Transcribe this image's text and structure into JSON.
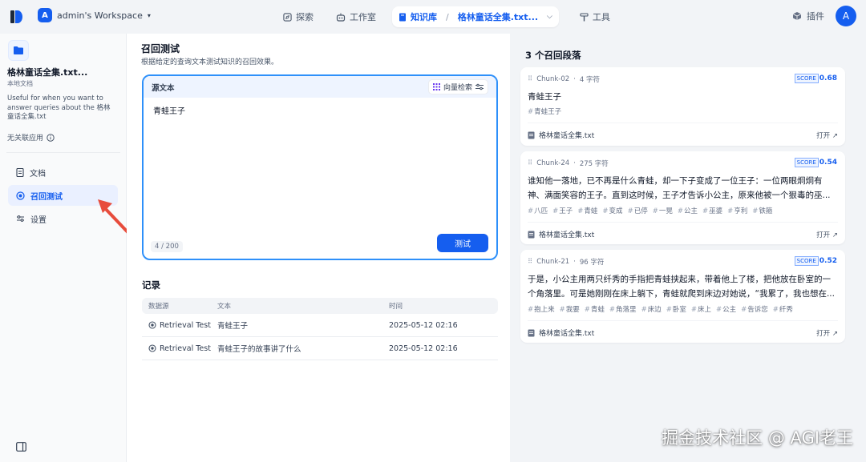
{
  "workspace": {
    "initial": "A",
    "name": "admin's Workspace"
  },
  "nav": {
    "explore": "探索",
    "studio": "工作室",
    "kb": "知识库",
    "kb_current": "格林童话全集.txt...",
    "tools": "工具"
  },
  "topright": {
    "plugins": "插件",
    "user_initial": "A"
  },
  "sidebar": {
    "kb_title": "格林童话全集.txt...",
    "kb_type": "本地文档",
    "kb_desc": "Useful for when you want to answer queries about the 格林童话全集.txt",
    "unlinked": "无关联应用",
    "items": [
      {
        "label": "文档"
      },
      {
        "label": "召回测试"
      },
      {
        "label": "设置"
      }
    ]
  },
  "main": {
    "title": "召回测试",
    "subtitle": "根据给定的查询文本测试知识的召回效果。",
    "source_label": "源文本",
    "vector_search": "向量检索",
    "query": "青蛙王子",
    "count": "4 / 200",
    "test_button": "测试",
    "records_title": "记录",
    "columns": [
      "数据源",
      "文本",
      "时间"
    ],
    "records": [
      {
        "source": "Retrieval Test",
        "text": "青蛙王子",
        "time": "2025-05-12 02:16"
      },
      {
        "source": "Retrieval Test",
        "text": "青蛙王子的故事讲了什么",
        "time": "2025-05-12 02:16"
      }
    ]
  },
  "results": {
    "title": "3 个召回段落",
    "score_label": "SCORE",
    "open": "打开 ↗",
    "chunks": [
      {
        "id": "Chunk-02",
        "chars": "4 字符",
        "score": "0.68",
        "text": "青蛙王子",
        "tags": [
          "青蛙王子"
        ],
        "file": "格林童话全集.txt"
      },
      {
        "id": "Chunk-24",
        "chars": "275 字符",
        "score": "0.54",
        "text": "谁知他一落地，已不再是什么青蛙，却一下子变成了一位王子：一位两眼炯炯有神、满面笑容的王子。直到这时候，王子才告诉小公主，原来他被一个狠毒的巫...",
        "tags": [
          "八匹",
          "王子",
          "青蛙",
          "变成",
          "已停",
          "一晃",
          "公主",
          "巫婆",
          "亨利",
          "铁箍"
        ],
        "file": "格林童话全集.txt"
      },
      {
        "id": "Chunk-21",
        "chars": "96 字符",
        "score": "0.52",
        "text": "于是，小公主用两只纤秀的手指把青蛙挟起来，带着他上了楼，把他放在卧室的一个角落里。可是她刚刚在床上躺下，青蛙就爬到床边对她说，“我累了，我也想在...",
        "tags": [
          "抱上来",
          "我要",
          "青蛙",
          "角落里",
          "床边",
          "卧室",
          "床上",
          "公主",
          "告诉您",
          "纤秀"
        ],
        "file": "格林童话全集.txt"
      }
    ]
  },
  "watermark": "掘金技术社区 @ AGI老王"
}
